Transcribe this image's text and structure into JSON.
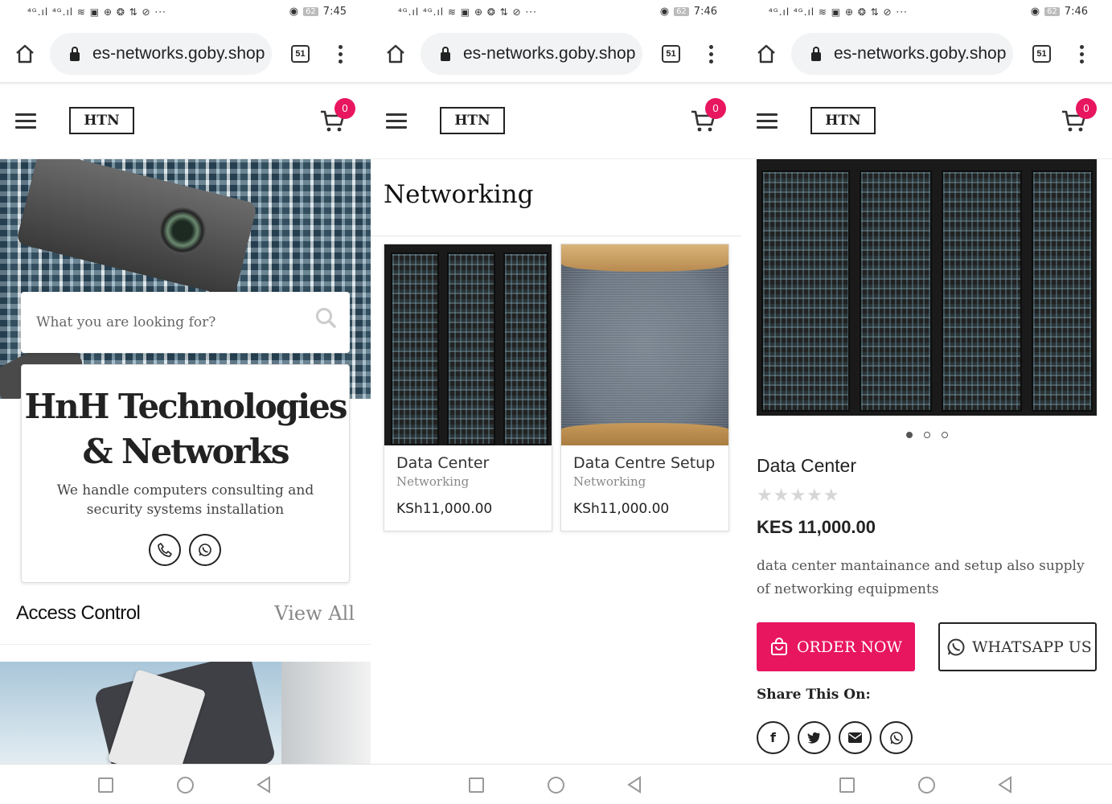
{
  "phones": [
    {
      "time": "7:45",
      "battery": "62",
      "url": "es-networks.goby.shop",
      "tabs": "51",
      "cart_count": "0"
    },
    {
      "time": "7:46",
      "battery": "62",
      "url": "es-networks.goby.shop",
      "tabs": "51",
      "cart_count": "0"
    },
    {
      "time": "7:46",
      "battery": "62",
      "url": "es-networks.goby.shop",
      "tabs": "51",
      "cart_count": "0"
    }
  ],
  "status_left": "⁴ᴳ.ıl ⁴ᴳ.ıl ≋ ▣ ⊕ ❂ ⇅ ⊘ ···",
  "logo": "HTN",
  "home": {
    "search_placeholder": "What you are looking for?",
    "title": "HnH Technologies & Networks",
    "subtitle": "We handle computers consulting and security systems installation",
    "section_title": "Access Control",
    "view_all": "View All"
  },
  "category": {
    "title": "Networking",
    "products": [
      {
        "name": "Data Center",
        "category": "Networking",
        "price": "KSh11,000.00"
      },
      {
        "name": "Data Centre Setup",
        "category": "Networking",
        "price": "KSh11,000.00"
      }
    ]
  },
  "product": {
    "name": "Data Center",
    "rating": "★★★★★",
    "price": "KES 11,000.00",
    "description": "data center mantainance and setup also supply of networking equipments",
    "order_label": "ORDER NOW",
    "whatsapp_label": "WHATSAPP US",
    "share_label": "Share This On:",
    "share_icons": [
      "facebook-icon",
      "twitter-icon",
      "email-icon",
      "whatsapp-icon"
    ]
  },
  "colors": {
    "accent": "#e8155f",
    "text": "#222222",
    "muted": "#888888"
  }
}
